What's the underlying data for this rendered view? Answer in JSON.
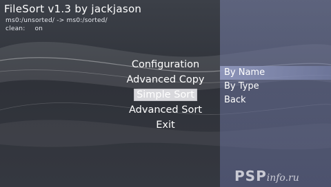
{
  "app": {
    "title": "FileSort v1.3 by jackjason",
    "path_line": "ms0:/unsorted/  ->  ms0:/sorted/",
    "clean_label": "clean:",
    "clean_value": "on"
  },
  "main_menu": {
    "items": [
      {
        "label": "Configuration"
      },
      {
        "label": "Advanced Copy"
      },
      {
        "label": "Simple Sort"
      },
      {
        "label": "Advanced Sort"
      },
      {
        "label": "Exit"
      }
    ],
    "selected_index": 2
  },
  "sub_menu": {
    "items": [
      {
        "label": "By Name"
      },
      {
        "label": "By Type"
      },
      {
        "label": "Back"
      }
    ],
    "highlighted_index": 0
  },
  "watermark": {
    "main": "PSP",
    "sub": "info.ru"
  },
  "colors": {
    "background": "#353840",
    "panel": "#7880a8",
    "text": "#ffffff",
    "selection": "#d8d8dc"
  }
}
